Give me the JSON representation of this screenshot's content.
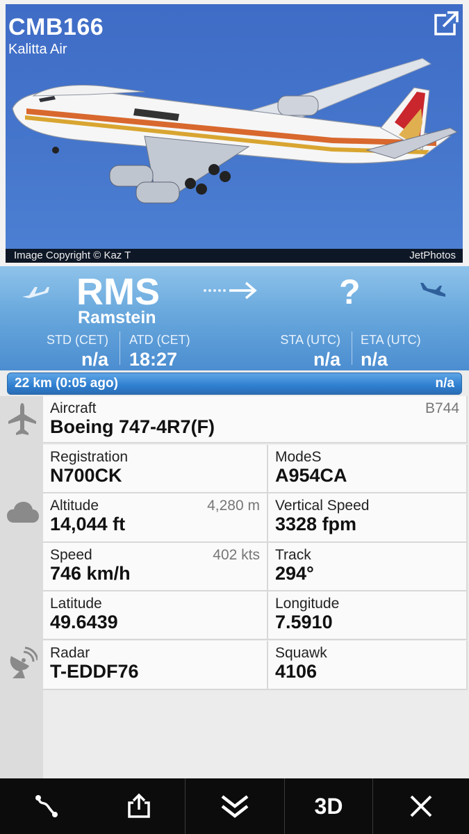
{
  "flight": {
    "code": "CMB166",
    "airline": "Kalitta Air",
    "photo_credit": "Image Copyright © Kaz T",
    "photo_source": "JetPhotos"
  },
  "route": {
    "origin_code": "RMS",
    "origin_city": "Ramstein",
    "destination_code": "?",
    "times": [
      {
        "label": "STD (CET)",
        "value": "n/a"
      },
      {
        "label": "ATD (CET)",
        "value": "18:27"
      },
      {
        "label": "STA (UTC)",
        "value": "n/a"
      },
      {
        "label": "ETA (UTC)",
        "value": "n/a"
      }
    ]
  },
  "progress": {
    "left_text": "22 km (0:05 ago)",
    "right_text": "n/a",
    "fraction": 0.0
  },
  "details": {
    "aircraft": {
      "label": "Aircraft",
      "value": "Boeing 747-4R7(F)",
      "extra": "B744"
    },
    "registration": {
      "label": "Registration",
      "value": "N700CK"
    },
    "modes": {
      "label": "ModeS",
      "value": "A954CA"
    },
    "altitude": {
      "label": "Altitude",
      "value": "14,044 ft",
      "extra": "4,280 m"
    },
    "vertical_speed": {
      "label": "Vertical Speed",
      "value": "3328 fpm"
    },
    "speed": {
      "label": "Speed",
      "value": "746 km/h",
      "extra": "402 kts"
    },
    "track": {
      "label": "Track",
      "value": "294°"
    },
    "latitude": {
      "label": "Latitude",
      "value": "49.6439"
    },
    "longitude": {
      "label": "Longitude",
      "value": "7.5910"
    },
    "radar": {
      "label": "Radar",
      "value": "T-EDDF76"
    },
    "squawk": {
      "label": "Squawk",
      "value": "4106"
    }
  },
  "toolbar": {
    "three_d_label": "3D"
  },
  "icons": {
    "open": "external-link-icon",
    "departure": "takeoff-icon",
    "arrival": "landing-icon",
    "aircraft_section": "airplane-icon",
    "weather_section": "cloud-icon",
    "radar_section": "radar-dish-icon",
    "route": "route-icon",
    "share": "share-icon",
    "collapse": "double-chevron-down-icon",
    "close": "close-icon"
  },
  "colors": {
    "route_panel": "#69a8dd",
    "progress_bar": "#2f7fd0",
    "toolbar": "#0c0c0c"
  }
}
